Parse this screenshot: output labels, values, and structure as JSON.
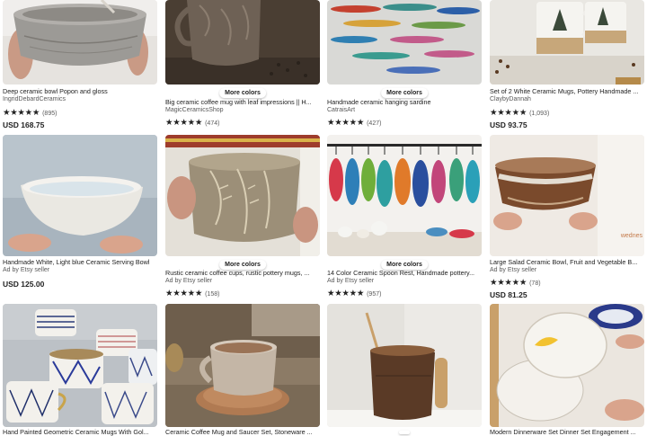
{
  "rating_stars": "★★★★★",
  "more_colors_label": "More colors",
  "listings": [
    {
      "title": "Deep ceramic bowl Popon and gloss",
      "seller": "IngridDebardCeramics",
      "reviews": "(895)",
      "price": "USD 168.75",
      "more_colors": false,
      "image": "grey-ceramic-bowl-photo"
    },
    {
      "title": "Big ceramic coffee mug with leaf impressions || H...",
      "seller": "MagicCeramicsShop",
      "reviews": "(474)",
      "price": "",
      "more_colors": true,
      "image": "brown-leaf-mug-photo"
    },
    {
      "title": "Handmade ceramic hanging sardine",
      "seller": "CatraisArt",
      "reviews": "(427)",
      "price": "",
      "more_colors": true,
      "image": "sardine-ornaments-photo"
    },
    {
      "title": "Set of 2 White Ceramic Mugs, Pottery Handmade ...",
      "seller": "ClaybyDannah",
      "reviews": "(1,093)",
      "price": "USD 93.75",
      "more_colors": false,
      "image": "white-tree-mugs-photo"
    },
    {
      "title": "Handmade White, Light blue Ceramic Serving Bowl",
      "seller": "Ad by Etsy seller",
      "reviews": "",
      "price": "USD 125.00",
      "more_colors": false,
      "image": "light-blue-bowl-photo"
    },
    {
      "title": "Rustic ceramic coffee cups, rustic pottery mugs, ...",
      "seller": "Ad by Etsy seller",
      "reviews": "(158)",
      "price": "",
      "more_colors": true,
      "image": "rustic-fern-cup-photo"
    },
    {
      "title": "14 Color Ceramic Spoon Rest, Handmade pottery...",
      "seller": "Ad by Etsy seller",
      "reviews": "(957)",
      "price": "",
      "more_colors": true,
      "image": "spoon-rests-photo"
    },
    {
      "title": "Large Salad Ceramic Bowl, Fruit and Vegetable B...",
      "seller": "Ad by Etsy seller",
      "reviews": "(78)",
      "price": "USD 81.25",
      "more_colors": false,
      "image": "brown-salad-bowl-photo",
      "watermark": "wednes"
    },
    {
      "title": "Hand Painted Geometric Ceramic Mugs With Gol...",
      "seller": "",
      "reviews": "",
      "price": "",
      "more_colors": false,
      "image": "geometric-mugs-photo"
    },
    {
      "title": "Ceramic Coffee Mug and Saucer Set, Stoneware ...",
      "seller": "",
      "reviews": "",
      "price": "",
      "more_colors": false,
      "image": "mug-saucer-photo"
    },
    {
      "title": "",
      "seller": "",
      "reviews": "",
      "price": "",
      "more_colors": false,
      "image": "wooden-handle-mug-photo"
    },
    {
      "title": "Modern Dinnerware Set Dinner Set Engagement ...",
      "seller": "",
      "reviews": "",
      "price": "",
      "more_colors": false,
      "image": "dinner-plates-photo"
    }
  ]
}
